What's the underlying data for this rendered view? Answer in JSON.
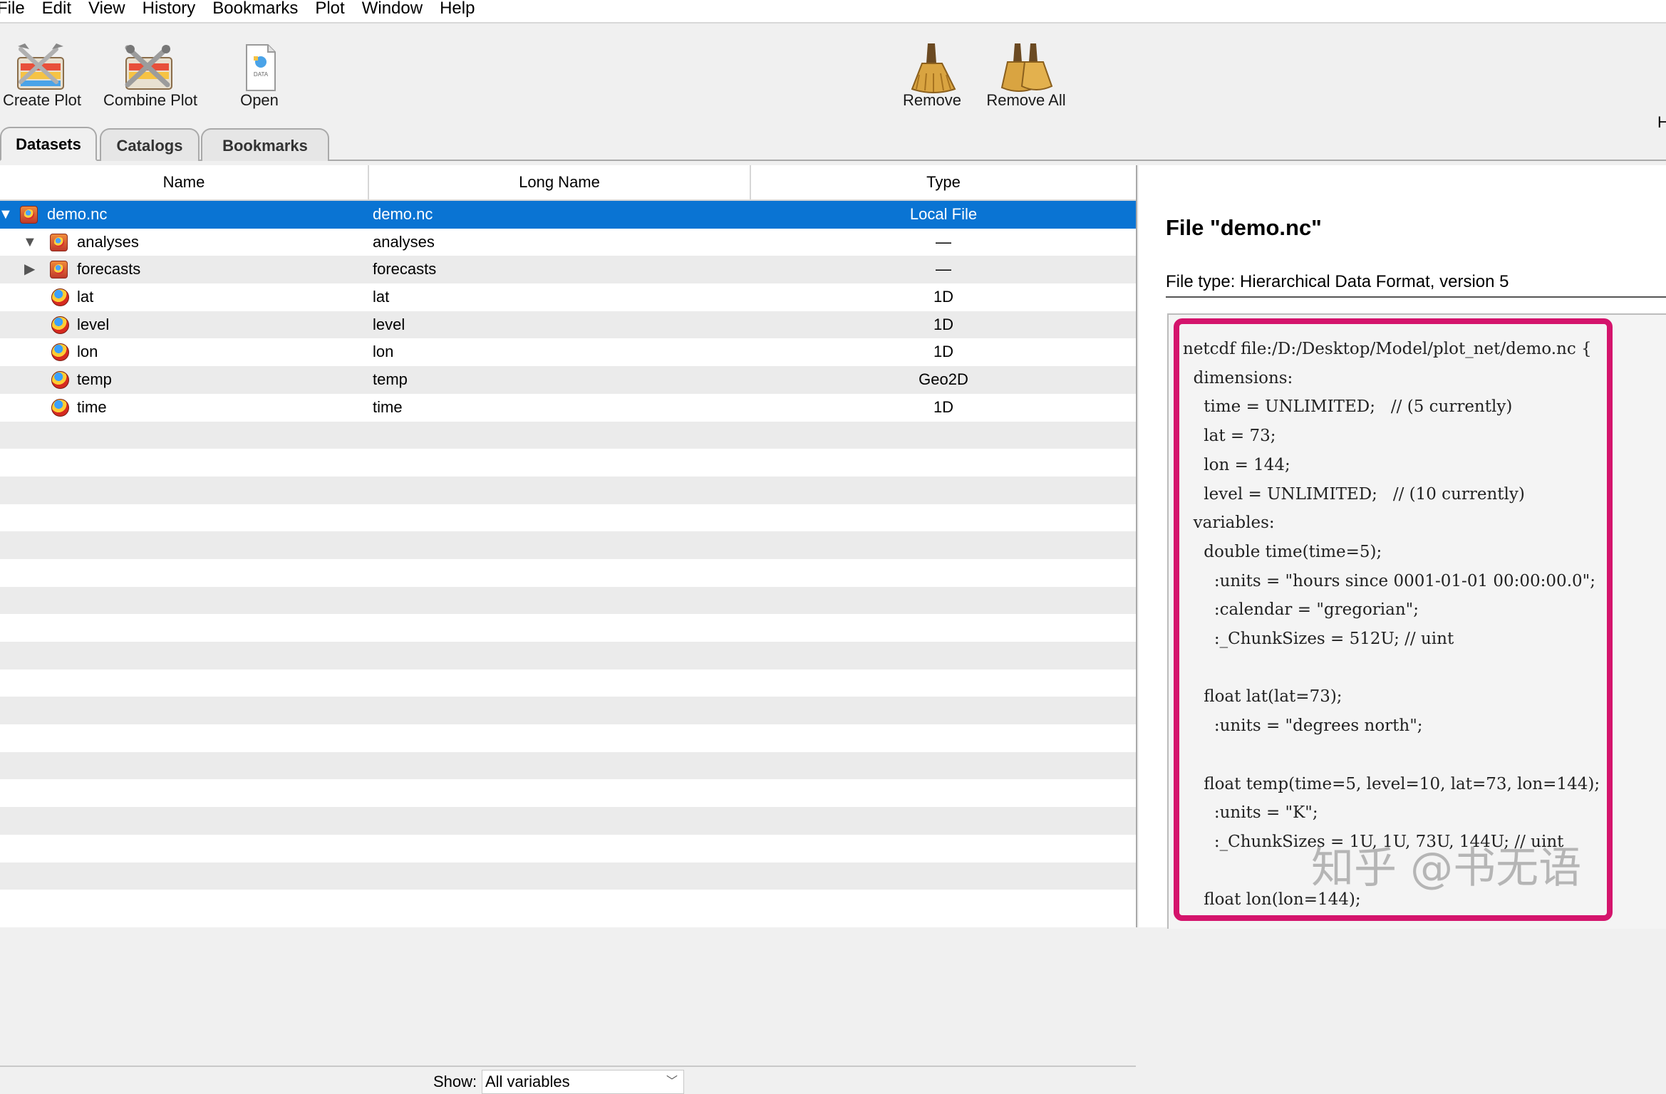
{
  "menubar": {
    "items": [
      "File",
      "Edit",
      "View",
      "History",
      "Bookmarks",
      "Plot",
      "Window",
      "Help"
    ]
  },
  "toolbar": {
    "create_plot": "Create Plot",
    "combine_plot": "Combine Plot",
    "open": "Open",
    "open_icon_text": "DATA",
    "remove": "Remove",
    "remove_all": "Remove All",
    "right_edge": "H"
  },
  "tabs": [
    "Datasets",
    "Catalogs",
    "Bookmarks"
  ],
  "table": {
    "columns": [
      "Name",
      "Long Name",
      "Type"
    ],
    "rows": [
      {
        "name": "demo.nc",
        "long_name": "demo.nc",
        "type": "Local File"
      },
      {
        "name": "analyses",
        "long_name": "analyses",
        "type": "—"
      },
      {
        "name": "forecasts",
        "long_name": "forecasts",
        "type": "—"
      },
      {
        "name": "lat",
        "long_name": "lat",
        "type": "1D"
      },
      {
        "name": "level",
        "long_name": "level",
        "type": "1D"
      },
      {
        "name": "lon",
        "long_name": "lon",
        "type": "1D"
      },
      {
        "name": "temp",
        "long_name": "temp",
        "type": "Geo2D"
      },
      {
        "name": "time",
        "long_name": "time",
        "type": "1D"
      }
    ]
  },
  "show": {
    "label": "Show:",
    "value": "All variables"
  },
  "details": {
    "title": "File \"demo.nc\"",
    "file_type": "File type: Hierarchical Data Format, version 5",
    "code_lines": [
      "netcdf file:/D:/Desktop/Model/plot_net/demo.nc {",
      "  dimensions:",
      "    time = UNLIMITED;   // (5 currently)",
      "    lat = 73;",
      "    lon = 144;",
      "    level = UNLIMITED;   // (10 currently)",
      "  variables:",
      "    double time(time=5);",
      "      :units = \"hours since 0001-01-01 00:00:00.0\";",
      "      :calendar = \"gregorian\";",
      "      :_ChunkSizes = 512U; // uint",
      "",
      "    float lat(lat=73);",
      "      :units = \"degrees north\";",
      "",
      "    float temp(time=5, level=10, lat=73, lon=144);",
      "      :units = \"K\";",
      "      :_ChunkSizes = 1U, 1U, 73U, 144U; // uint",
      "",
      "    float lon(lon=144);"
    ]
  },
  "watermark": "知乎 @书无语",
  "colors": {
    "selection": "#0a74d3",
    "highlight": "#d4146c"
  }
}
